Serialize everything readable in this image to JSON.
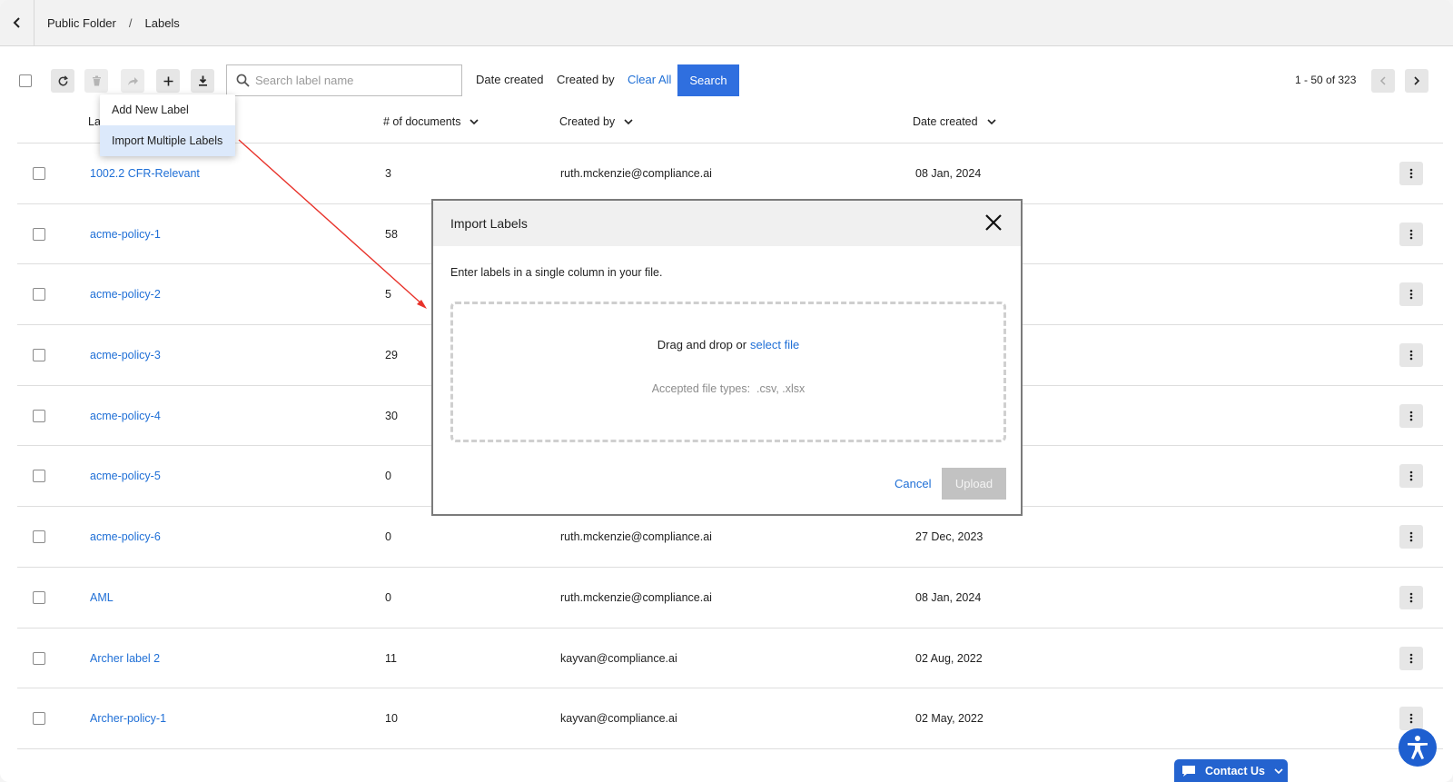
{
  "breadcrumb": {
    "parent": "Public Folder",
    "separator": "/",
    "current": "Labels"
  },
  "toolbar": {
    "search_placeholder": "Search label name",
    "filter_date": "Date created",
    "filter_created_by": "Created by",
    "clear_all": "Clear All",
    "search_button": "Search",
    "pagination": "1 - 50 of 323"
  },
  "dropdown": {
    "items": [
      {
        "label": "Add New Label"
      },
      {
        "label": "Import Multiple Labels"
      }
    ]
  },
  "table": {
    "columns": {
      "label": "La",
      "docs": "# of documents",
      "created_by": "Created by",
      "date_created": "Date created"
    },
    "rows": [
      {
        "label": "1002.2 CFR-Relevant",
        "docs": "3",
        "created_by": "ruth.mckenzie@compliance.ai",
        "date": "08 Jan, 2024"
      },
      {
        "label": "acme-policy-1",
        "docs": "58",
        "created_by": "",
        "date": ""
      },
      {
        "label": "acme-policy-2",
        "docs": "5",
        "created_by": "",
        "date": ""
      },
      {
        "label": "acme-policy-3",
        "docs": "29",
        "created_by": "",
        "date": ""
      },
      {
        "label": "acme-policy-4",
        "docs": "30",
        "created_by": "",
        "date": ""
      },
      {
        "label": "acme-policy-5",
        "docs": "0",
        "created_by": "",
        "date": ""
      },
      {
        "label": "acme-policy-6",
        "docs": "0",
        "created_by": "ruth.mckenzie@compliance.ai",
        "date": "27 Dec, 2023"
      },
      {
        "label": "AML",
        "docs": "0",
        "created_by": "ruth.mckenzie@compliance.ai",
        "date": "08 Jan, 2024"
      },
      {
        "label": "Archer label 2",
        "docs": "11",
        "created_by": "kayvan@compliance.ai",
        "date": "02 Aug, 2022"
      },
      {
        "label": "Archer-policy-1",
        "docs": "10",
        "created_by": "kayvan@compliance.ai",
        "date": "02 May, 2022"
      }
    ]
  },
  "modal": {
    "title": "Import Labels",
    "instruction": "Enter labels in a single column in your file.",
    "drag_text": "Drag and drop or",
    "select_file": "select file",
    "accepted_label": "Accepted file types:",
    "accepted_types": ".csv, .xlsx",
    "cancel": "Cancel",
    "upload": "Upload"
  },
  "contact": {
    "label": "Contact Us"
  },
  "icons": {
    "back": "chevron-left-icon",
    "refresh": "refresh-icon",
    "delete": "trash-icon",
    "share": "share-arrow-icon",
    "add": "plus-icon",
    "download": "download-icon",
    "search": "search-icon",
    "close": "close-icon",
    "kebab": "kebab-icon",
    "accessibility": "accessibility-icon",
    "chat": "chat-bubble-icon"
  },
  "colors": {
    "primary": "#2f6fdf",
    "link": "#1f6fd6",
    "annotation_arrow": "#e8322a",
    "disabled": "#c2c2c2"
  }
}
